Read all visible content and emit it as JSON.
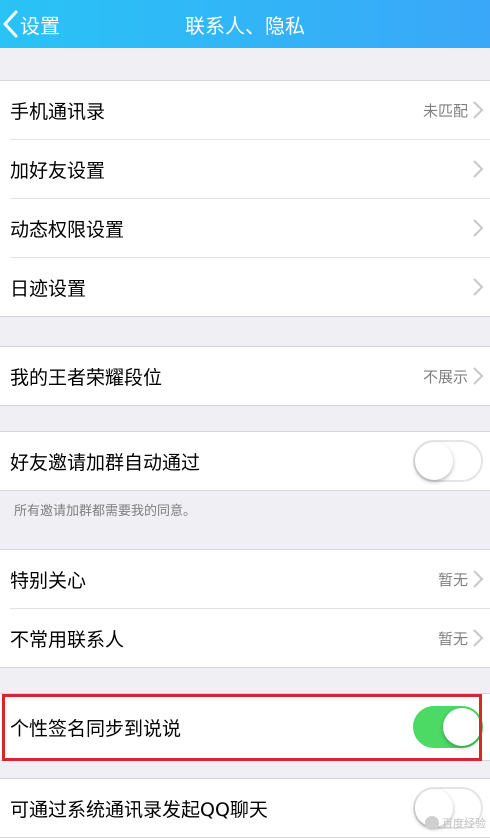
{
  "header": {
    "back_label": "设置",
    "title": "联系人、隐私"
  },
  "groups": [
    {
      "rows": [
        {
          "label": "手机通讯录",
          "value": "未匹配"
        },
        {
          "label": "加好友设置",
          "value": ""
        },
        {
          "label": "动态权限设置",
          "value": ""
        },
        {
          "label": "日迹设置",
          "value": ""
        }
      ]
    },
    {
      "rows": [
        {
          "label": "我的王者荣耀段位",
          "value": "不展示"
        }
      ]
    },
    {
      "rows": [
        {
          "label": "好友邀请加群自动通过",
          "toggle": false
        }
      ],
      "note": "所有邀请加群都需要我的同意。"
    },
    {
      "rows": [
        {
          "label": "特别关心",
          "value": "暂无"
        },
        {
          "label": "不常用联系人",
          "value": "暂无"
        }
      ]
    },
    {
      "rows": [
        {
          "label": "个性签名同步到说说",
          "toggle": true
        }
      ]
    },
    {
      "rows": [
        {
          "label": "可通过系统通讯录发起QQ聊天",
          "toggle": false
        }
      ]
    }
  ],
  "colors": {
    "header_start": "#29c3f6",
    "header_end": "#3aa7f8",
    "toggle_on": "#4cd964",
    "highlight_border": "#d8262f"
  },
  "watermark": "百度经验"
}
